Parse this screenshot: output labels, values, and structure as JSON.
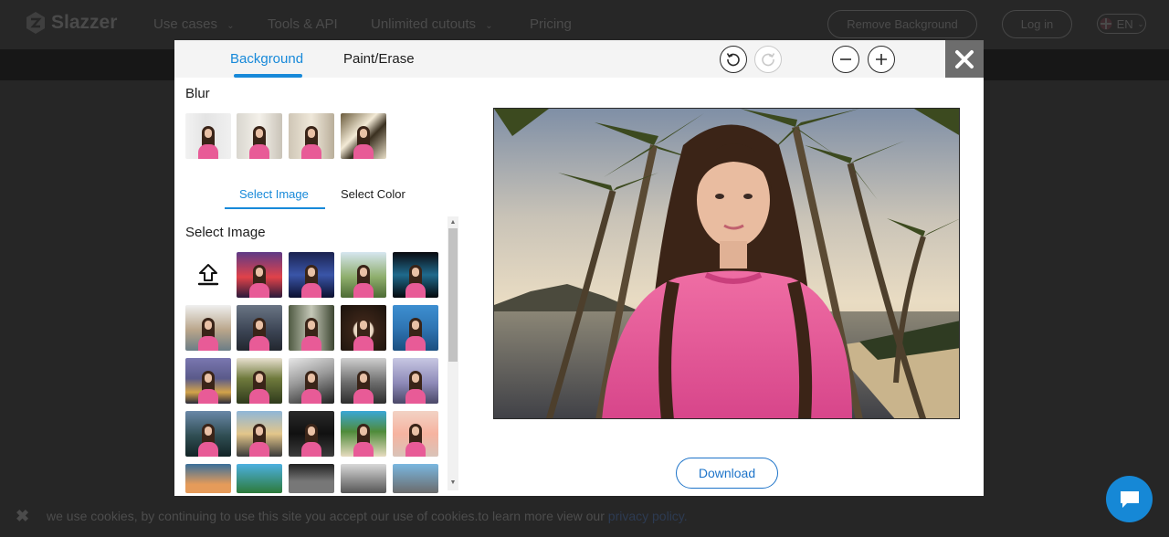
{
  "site": {
    "brand": "Slazzer",
    "nav": [
      {
        "label": "Use cases",
        "has_dropdown": true
      },
      {
        "label": "Tools & API",
        "has_dropdown": false
      },
      {
        "label": "Unlimited cutouts",
        "has_dropdown": true
      },
      {
        "label": "Pricing",
        "has_dropdown": false
      }
    ],
    "remove_bg_label": "Remove Background",
    "login_label": "Log in",
    "language_label": "EN"
  },
  "editor": {
    "tabs": [
      {
        "label": "Background",
        "active": true
      },
      {
        "label": "Paint/Erase",
        "active": false
      }
    ],
    "blur_label": "Blur",
    "subtabs": [
      {
        "label": "Select Image",
        "active": true
      },
      {
        "label": "Select Color",
        "active": false
      }
    ],
    "select_image_heading": "Select Image",
    "download_label": "Download",
    "icons": {
      "undo": "undo-icon",
      "redo": "redo-icon",
      "zoom_out": "zoom-out-icon",
      "zoom_in": "zoom-in-icon",
      "close": "close-icon",
      "upload": "upload-icon",
      "chat": "chat-icon"
    }
  },
  "cookie": {
    "text": "we use cookies, by continuing to use this site you accept our use of cookies.to learn more view our ",
    "link_label": "privacy policy."
  },
  "colors": {
    "accent": "#1789d9",
    "download": "#1e74c9",
    "close_bg": "#6d6d6d",
    "chat": "#1688d6"
  }
}
